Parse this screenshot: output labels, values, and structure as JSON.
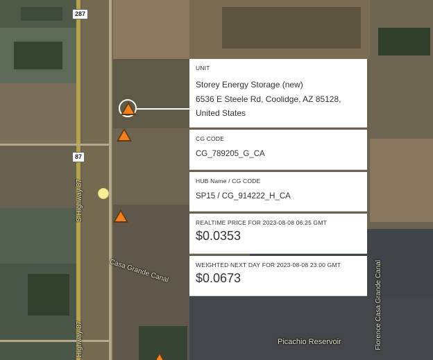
{
  "map": {
    "highway_shield_top": "287",
    "highway_shield_mid": "87",
    "highway_label": "S Highway 87",
    "highway_label_bottom": "Highway 87",
    "canal_label": "Casa Grande Canal",
    "canal_label_right": "Florence Casa Grande Canal",
    "reservoir_label": "Picachio Reservoir",
    "marker_color": "#f38020",
    "selected_marker_color": "#ffffff"
  },
  "panel": {
    "unit": {
      "label": "UNIT",
      "name": "Storey Energy Storage (new)",
      "address": "6536 E Steele Rd, Coolidge, AZ 85128, United States"
    },
    "cg_code": {
      "label": "CG CODE",
      "value": "CG_789205_G_CA"
    },
    "hub": {
      "label": "HUB Name / CG CODE",
      "value": "SP15 / CG_914222_H_CA"
    },
    "realtime": {
      "label": "REALTIME PRICE FOR 2023-08-08 06:25 GMT",
      "value": "$0.0353"
    },
    "weighted": {
      "label": "WEIGHTED NEXT DAY FOR 2023-08-08 23:00 GMT",
      "value": "$0.0673"
    }
  }
}
